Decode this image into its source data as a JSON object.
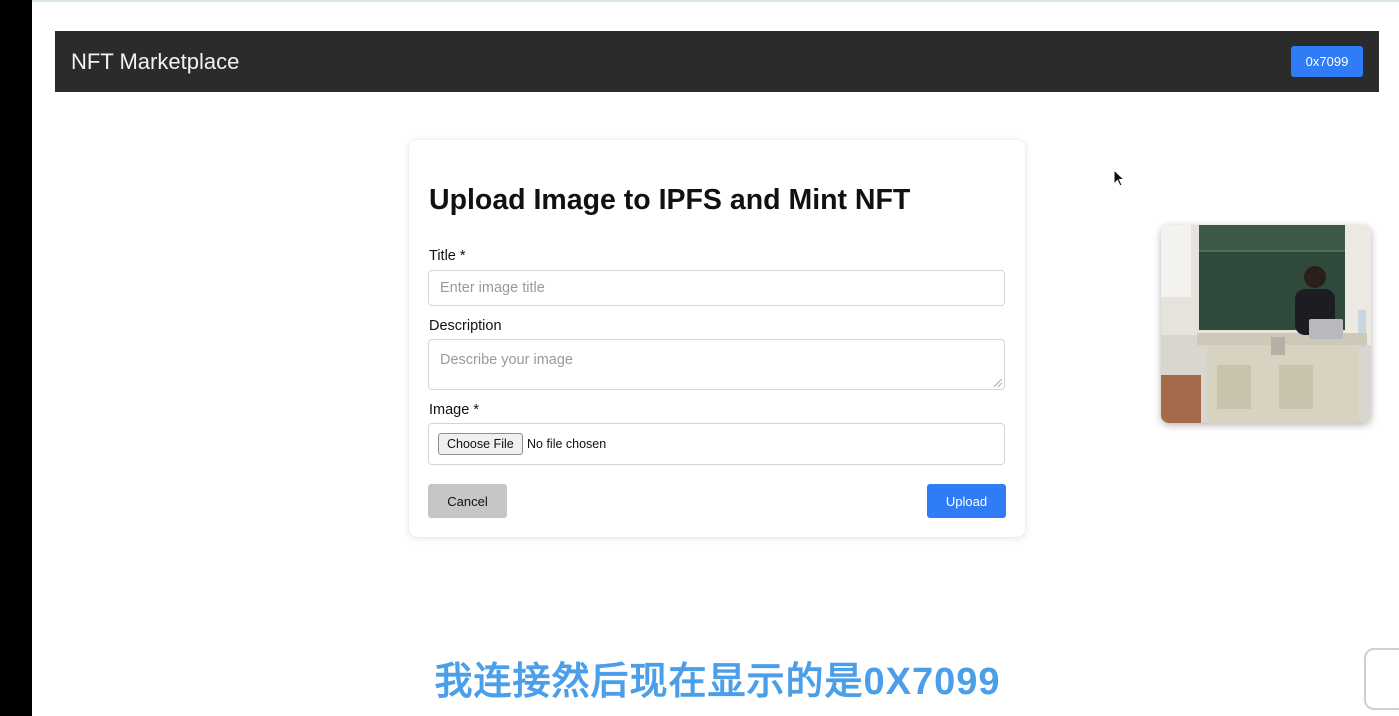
{
  "navbar": {
    "brand": "NFT Marketplace",
    "wallet_label": "0x7099"
  },
  "form": {
    "heading": "Upload Image to IPFS and Mint NFT",
    "title_label": "Title *",
    "title_placeholder": "Enter image title",
    "title_value": "",
    "description_label": "Description",
    "description_placeholder": "Describe your image",
    "description_value": "",
    "image_label": "Image *",
    "choose_file_label": "Choose File",
    "file_status": "No file chosen",
    "cancel_label": "Cancel",
    "upload_label": "Upload"
  },
  "subtitle": "我连接然后现在显示的是0X7099",
  "colors": {
    "navbar_bg": "#2b2b2b",
    "primary": "#2f7cf6",
    "cancel_bg": "#c6c6c6",
    "subtitle": "#4a9fe8"
  },
  "icons": [
    "mouse-cursor-icon",
    "resize-grip-icon"
  ]
}
